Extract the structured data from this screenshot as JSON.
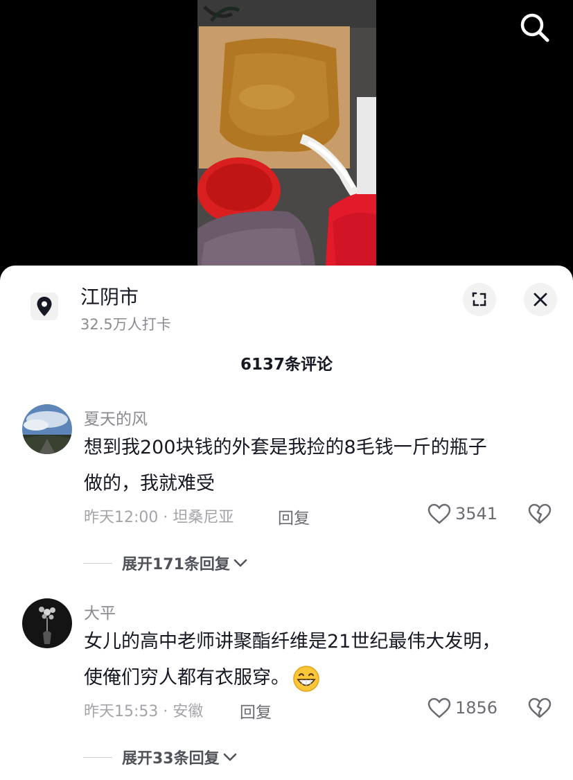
{
  "location": {
    "name": "江阴市",
    "checkins": "32.5万人打卡"
  },
  "header": {
    "comment_count": "6137条评论"
  },
  "comments": [
    {
      "username": "夏天的风",
      "text_line1": "想到我200块钱的外套是我捡的8毛钱一斤的瓶子",
      "text_line2": "做的，我就难受",
      "meta": "昨天12:00 · 坦桑尼亚",
      "reply_label": "回复",
      "likes": "3541",
      "expand_label": "展开171条回复"
    },
    {
      "username": "大平",
      "text_line1": "女儿的高中老师讲聚酯纤维是21世纪最伟大发明，",
      "text_line2": "使俺们穷人都有衣服穿。",
      "meta": "昨天15:53 · 安徽",
      "reply_label": "回复",
      "likes": "1856",
      "expand_label": "展开33条回复"
    }
  ],
  "colors": {
    "sheet_bg": "#ffffff",
    "primary_text": "#161823",
    "secondary_text": "#8a8b91",
    "video_bg": "#000000"
  },
  "icons": [
    "search-icon",
    "location-pin-icon",
    "expand-icon",
    "close-icon",
    "heart-icon",
    "broken-heart-icon",
    "chevron-down-icon",
    "grin-emoji-icon"
  ]
}
